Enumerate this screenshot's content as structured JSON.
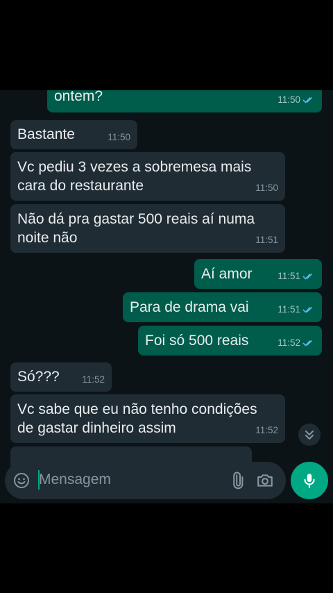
{
  "messages": [
    {
      "side": "out",
      "text": "ontem?",
      "time": "11:50",
      "read": true
    },
    {
      "side": "in",
      "text": "Bastante",
      "time": "11:50"
    },
    {
      "side": "in",
      "line1": "Vc pediu 3 vezes a sobremesa mais",
      "line2": "cara do restaurante",
      "time": "11:50"
    },
    {
      "side": "in",
      "line1": "Não dá pra gastar 500 reais aí numa",
      "line2": "noite não",
      "time": "11:51"
    },
    {
      "side": "out",
      "text": "Aí amor",
      "time": "11:51",
      "read": true
    },
    {
      "side": "out",
      "text": "Para de drama vai",
      "time": "11:51",
      "read": true
    },
    {
      "side": "out",
      "text": "Foi só 500 reais",
      "time": "11:52",
      "read": true
    },
    {
      "side": "in",
      "text": "Só???",
      "time": "11:52"
    },
    {
      "side": "in",
      "line1": "Vc sabe que eu não tenho condições",
      "line2": "de gastar dinheiro assim",
      "time": "11:52"
    }
  ],
  "composer": {
    "placeholder": "Mensagem",
    "icons": [
      "emoji-icon",
      "attach-icon",
      "camera-icon",
      "mic-icon"
    ]
  },
  "colors": {
    "chat_bg": "#0c1317",
    "incoming_bubble": "#202c33",
    "outgoing_bubble": "#005c4b",
    "read_ticks": "#53bdeb",
    "accent": "#00a884"
  }
}
